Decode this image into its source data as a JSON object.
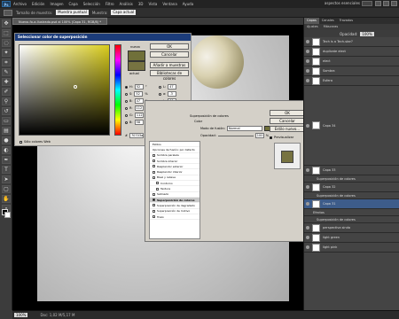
{
  "menubar": {
    "logo": "Ps",
    "items": [
      "Archivo",
      "Edición",
      "Imagen",
      "Capa",
      "Selección",
      "Filtro",
      "Análisis",
      "3D",
      "Vista",
      "Ventana",
      "Ayuda"
    ],
    "workspace": "aspectos esenciales"
  },
  "options": {
    "size_label": "Tamaño de muestra:",
    "size_value": "Muestra puntual",
    "sample_label": "Muestra:",
    "sample_value": "Capa actual"
  },
  "document": {
    "tab_label": "Nuevo-fo-a-llustrado.psd al 100% (Capa 31, RGB/8) *"
  },
  "status": {
    "zoom": "100%",
    "doc": "Doc: 1,02 M/5,17 M"
  },
  "picker": {
    "title": "Seleccionar color de superposición",
    "ok": "OK",
    "cancel": "Cancelar",
    "add_swatch": "Añadir a muestras",
    "libraries": "Bibliotecas de colores",
    "new_label": "nuevo",
    "current_label": "actual",
    "web_only": "Sólo colores Web",
    "fields": [
      {
        "label": "H:",
        "value": "52",
        "unit": "°"
      },
      {
        "label": "S:",
        "value": "52",
        "unit": "%"
      },
      {
        "label": "B:",
        "value": "47",
        "unit": "%"
      },
      {
        "label": "R:",
        "value": "112",
        "unit": ""
      },
      {
        "label": "G:",
        "value": "112",
        "unit": ""
      },
      {
        "label": "B:",
        "value": "58",
        "unit": ""
      }
    ],
    "lab_fields": [
      {
        "label": "L:",
        "value": "47"
      },
      {
        "label": "a:",
        "value": "-3"
      },
      {
        "label": "b:",
        "value": "31"
      },
      {
        "label": "C:",
        "value": "53",
        "unit": "%"
      },
      {
        "label": "M:",
        "value": "44",
        "unit": "%"
      },
      {
        "label": "Y:",
        "value": "83",
        "unit": "%"
      },
      {
        "label": "K:",
        "value": "22",
        "unit": "%"
      }
    ],
    "hex_label": "#",
    "hex": "70703a"
  },
  "layer_style": {
    "section": "Superposición de colores",
    "group": "Color",
    "blend_label": "Modo de fusión:",
    "blend_value": "Normal",
    "opacity_label": "Opacidad:",
    "opacity_value": "100",
    "opacity_unit": "%",
    "ok": "OK",
    "cancel": "Cancelar",
    "new_style": "Estilo nuevo...",
    "preview_label": "Previsualizar",
    "styles": [
      {
        "label": "Estilos",
        "checked": false,
        "indent": false
      },
      {
        "label": "Opciones de fusión: por defecto",
        "checked": false,
        "indent": false
      },
      {
        "label": "Sombra paralela",
        "checked": false,
        "indent": false
      },
      {
        "label": "Sombra interior",
        "checked": false,
        "indent": false
      },
      {
        "label": "Resplandor exterior",
        "checked": false,
        "indent": false
      },
      {
        "label": "Resplandor interior",
        "checked": false,
        "indent": false
      },
      {
        "label": "Bisel y relieve",
        "checked": false,
        "indent": false
      },
      {
        "label": "Contorno",
        "checked": false,
        "indent": true
      },
      {
        "label": "Textura",
        "checked": false,
        "indent": true
      },
      {
        "label": "Satinado",
        "checked": false,
        "indent": false
      },
      {
        "label": "Superposición de colores",
        "checked": true,
        "indent": false
      },
      {
        "label": "Superposición de degradado",
        "checked": false,
        "indent": false
      },
      {
        "label": "Superposición de motivo",
        "checked": false,
        "indent": false
      },
      {
        "label": "Trazo",
        "checked": false,
        "indent": false
      }
    ]
  },
  "panels": {
    "top_tabs": [
      "Capas",
      "Canales",
      "Trazados"
    ],
    "adj_tabs": [
      "Ajustes",
      "Máscaras"
    ],
    "opacity_label": "Opacidad:",
    "opacity_value": "100%",
    "layers": [
      {
        "name": "Tech is a Tech-star?",
        "sel": false
      },
      {
        "name": "duplicate elect",
        "sel": false
      },
      {
        "name": "elect",
        "sel": false
      },
      {
        "name": "Sombra",
        "sel": false
      },
      {
        "name": "Esfera",
        "sel": false
      },
      {
        "name": "Capa 34",
        "sel": false
      },
      {
        "name": "Capa 33",
        "sel": false
      },
      {
        "name": "Superposición de colores",
        "sel": false
      },
      {
        "name": "Capa 32",
        "sel": false
      },
      {
        "name": "Superposición de colores",
        "sel": false
      },
      {
        "name": "Capa 31",
        "sel": true
      },
      {
        "name": "Efectos",
        "sel": false
      },
      {
        "name": "Superposición de colores",
        "sel": false
      },
      {
        "name": "perspectiva sinda",
        "sel": false
      },
      {
        "name": "light green",
        "sel": false
      },
      {
        "name": "light pink",
        "sel": false
      }
    ]
  },
  "colors": {
    "new_color": "#70703a",
    "current_color": "#777341",
    "selected_layer": "#3d5c8a"
  }
}
